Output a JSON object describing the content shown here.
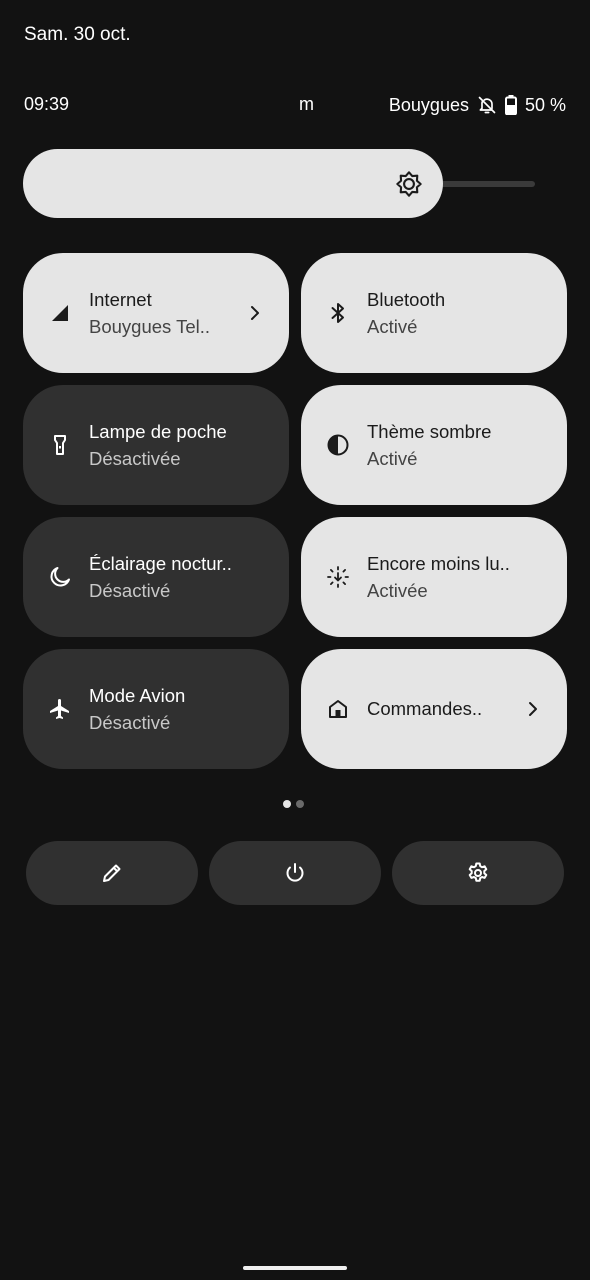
{
  "header": {
    "date": "Sam. 30 oct."
  },
  "status_bar": {
    "time": "09:39",
    "notification_char": "m",
    "carrier": "Bouygues",
    "battery": "50 %"
  },
  "brightness": {
    "level": 0.82
  },
  "tiles": [
    {
      "title": "Internet",
      "subtitle": "Bouygues Tel..",
      "state": "on",
      "icon": "signal-icon",
      "has_chevron": true
    },
    {
      "title": "Bluetooth",
      "subtitle": "Activé",
      "state": "on",
      "icon": "bluetooth-icon"
    },
    {
      "title": "Lampe de poche",
      "subtitle": "Désactivée",
      "state": "off",
      "icon": "flashlight-icon"
    },
    {
      "title": "Thème sombre",
      "subtitle": "Activé",
      "state": "on",
      "icon": "dark-theme-icon"
    },
    {
      "title": "Éclairage noctur..",
      "subtitle": "Désactivé",
      "state": "off",
      "icon": "moon-icon"
    },
    {
      "title": "Encore moins lu..",
      "subtitle": "Activée",
      "state": "on",
      "icon": "extra-dim-icon"
    },
    {
      "title": "Mode Avion",
      "subtitle": "Désactivé",
      "state": "off",
      "icon": "airplane-icon"
    },
    {
      "title": "Commandes..",
      "subtitle": "",
      "state": "on",
      "icon": "home-icon",
      "has_chevron": true
    }
  ],
  "pager": {
    "current": 1,
    "total": 2
  },
  "actions": [
    {
      "icon": "edit-pencil-icon"
    },
    {
      "icon": "power-icon"
    },
    {
      "icon": "settings-gear-icon"
    }
  ],
  "colors": {
    "background": "#121212",
    "tile_on": "#e5e5e5",
    "tile_off": "#303030"
  }
}
